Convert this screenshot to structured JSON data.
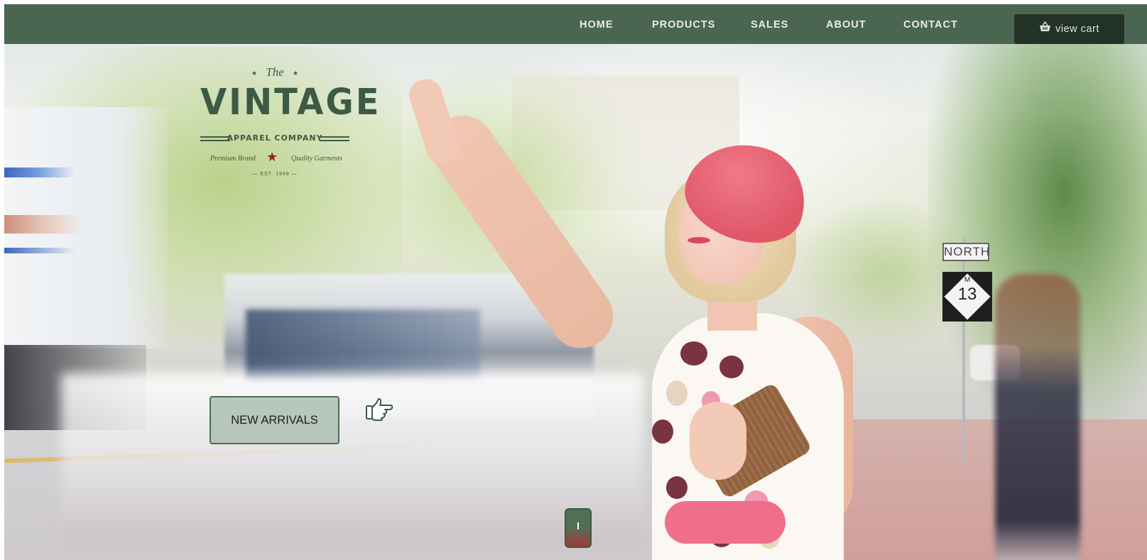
{
  "nav": {
    "links": [
      {
        "label": "HOME"
      },
      {
        "label": "PRODUCTS"
      },
      {
        "label": "SALES"
      },
      {
        "label": "ABOUT"
      },
      {
        "label": "CONTACT"
      }
    ],
    "cart_label": "view cart",
    "cart_icon": "basket-icon"
  },
  "logo": {
    "the": "The",
    "name": "VINTAGE",
    "company": "APPAREL COMPANY",
    "tag_left": "Premium Brand",
    "tag_right": "Quality Garments",
    "est": "— EST. 1949 —"
  },
  "hero": {
    "cta_label": "NEW ARRIVALS",
    "pointer_icon": "hand-pointing-right-icon",
    "sign_top": "NORTH",
    "sign_route_letter": "M",
    "sign_route_number": "13"
  },
  "scroll_button": {
    "icon": "scroll-indicator-icon"
  },
  "colors": {
    "nav_bg": "#4a6650",
    "cart_bg": "#233226",
    "brand_green": "#3d5a45",
    "cta_bg": "#b4c4b8",
    "hat_pink": "#e05768"
  }
}
